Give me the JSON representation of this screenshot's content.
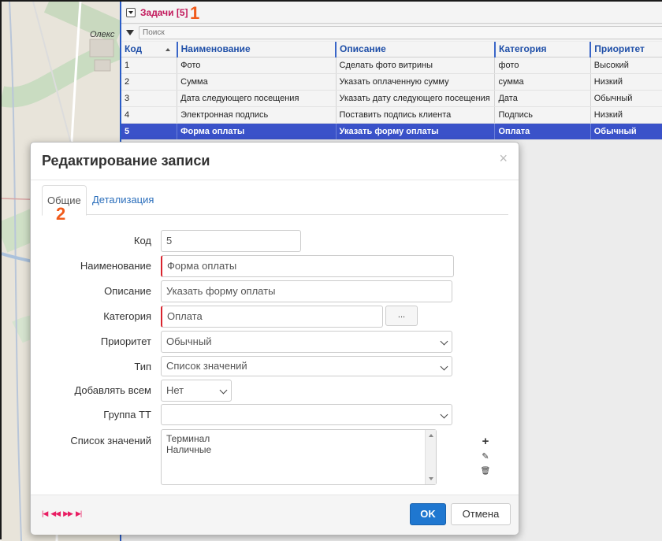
{
  "map": {
    "place_label": "Олекс"
  },
  "grid": {
    "title": "Задачи [5]",
    "marker": "1",
    "search_placeholder": "Поиск",
    "columns": [
      "Код",
      "Наименование",
      "Описание",
      "Категория",
      "Приоритет"
    ],
    "rows": [
      [
        "1",
        "Фото",
        "Сделать фото витрины",
        "фото",
        "Высокий"
      ],
      [
        "2",
        "Сумма",
        "Указать оплаченную сумму",
        "сумма",
        "Низкий"
      ],
      [
        "3",
        "Дата следующего посещения",
        "Указать дату следующего посещения",
        "Дата",
        "Обычный"
      ],
      [
        "4",
        "Электронная подпись",
        "Поставить подпись клиента",
        "Подпись",
        "Низкий"
      ],
      [
        "5",
        "Форма оплаты",
        "Указать форму оплаты",
        "Оплата",
        "Обычный"
      ]
    ],
    "selected_row": 4
  },
  "modal": {
    "title": "Редактирование записи",
    "close": "×",
    "tabs": {
      "general": "Общие",
      "details": "Детализация"
    },
    "tab_marker": "2",
    "labels": {
      "code": "Код",
      "name": "Наименование",
      "description": "Описание",
      "category": "Категория",
      "priority": "Приоритет",
      "type": "Тип",
      "add_all": "Добавлять всем",
      "group": "Группа ТТ",
      "values_list": "Список значений"
    },
    "values": {
      "code": "5",
      "name": "Форма оплаты",
      "description": "Указать форму оплаты",
      "category": "Оплата",
      "category_button": "...",
      "priority": "Обычный",
      "type": "Список значений",
      "add_all": "Нет",
      "group": ""
    },
    "values_list": [
      "Терминал",
      "Наличные"
    ],
    "tools": {
      "add": "+",
      "edit": "✎",
      "delete": "🗑"
    },
    "nav": {
      "first": "|◀",
      "prev": "◀◀",
      "next": "▶▶",
      "last": "▶|"
    },
    "buttons": {
      "ok": "OK",
      "cancel": "Отмена"
    }
  }
}
